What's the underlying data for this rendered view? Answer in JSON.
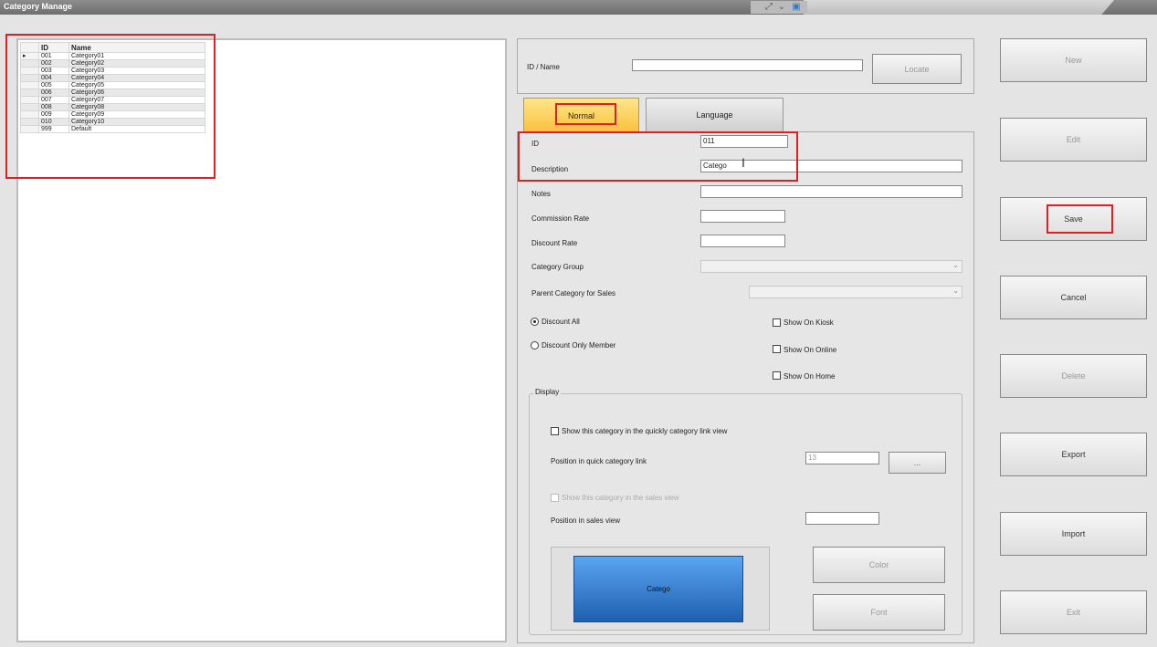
{
  "window": {
    "title": "Category Manage"
  },
  "grid": {
    "columns": [
      "ID",
      "Name"
    ],
    "rows": [
      {
        "id": "001",
        "name": "Category01"
      },
      {
        "id": "002",
        "name": "Category02"
      },
      {
        "id": "003",
        "name": "Category03"
      },
      {
        "id": "004",
        "name": "Category04"
      },
      {
        "id": "005",
        "name": "Category05"
      },
      {
        "id": "006",
        "name": "Category06"
      },
      {
        "id": "007",
        "name": "Category07"
      },
      {
        "id": "008",
        "name": "Category08"
      },
      {
        "id": "009",
        "name": "Category09"
      },
      {
        "id": "010",
        "name": "Category10"
      },
      {
        "id": "999",
        "name": "Default"
      }
    ],
    "selected_row": 0
  },
  "search": {
    "label": "ID / Name",
    "value": "",
    "locate_label": "Locate"
  },
  "tabs": {
    "normal": "Normal",
    "language": "Language",
    "active": "Normal"
  },
  "form": {
    "id_label": "ID",
    "id_value": "011",
    "description_label": "Description",
    "description_value": "Catego",
    "notes_label": "Notes",
    "notes_value": "",
    "commission_label": "Commission Rate",
    "commission_value": "",
    "discount_rate_label": "Discount Rate",
    "discount_rate_value": "",
    "category_group_label": "Category Group",
    "parent_category_label": "Parent Category for Sales",
    "discount_all_label": "Discount All",
    "discount_member_label": "Discount Only Member",
    "discount_mode": "Discount All",
    "show_kiosk_label": "Show On Kiosk",
    "show_online_label": "Show On Online",
    "show_home_label": "Show On Home",
    "display": {
      "legend": "Display",
      "quick_link_chk_label": "Show this category in the quickly category  link view",
      "quick_pos_label": "Position in quick category link",
      "quick_pos_value": "13",
      "quick_pos_btn": "...",
      "sales_view_chk_label": "Show this category in the sales view",
      "sales_pos_label": "Position in sales view",
      "sales_pos_value": "",
      "preview_label": "Catego",
      "color_label": "Color",
      "font_label": "Font"
    }
  },
  "actions": {
    "new": "New",
    "edit": "Edit",
    "save": "Save",
    "cancel": "Cancel",
    "delete": "Delete",
    "export": "Export",
    "import": "Import",
    "exit": "Exit"
  },
  "colors": {
    "highlight": "#e02020",
    "tab_active": "#f9c13a",
    "preview": "#1f5fb0"
  },
  "icons": [
    "resize-icon",
    "chevron-down-icon",
    "restore-icon",
    "text-cursor-icon",
    "row-pointer-icon"
  ]
}
